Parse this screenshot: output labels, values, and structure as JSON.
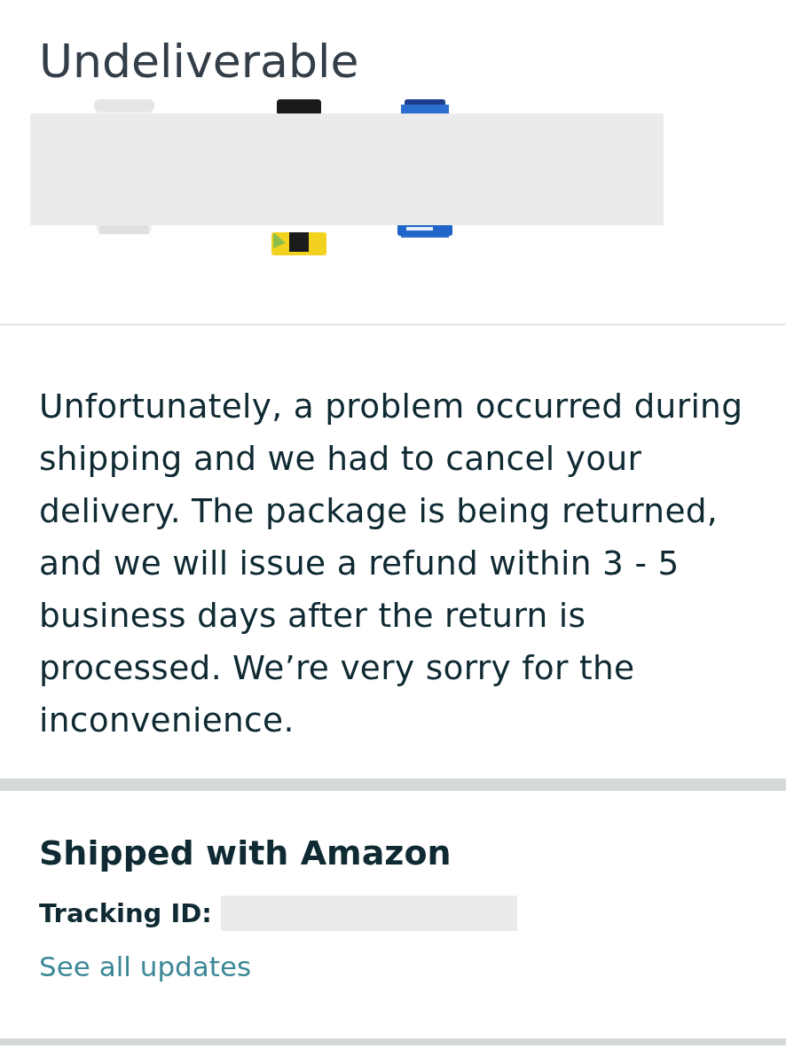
{
  "status": {
    "title": "Undeliverable"
  },
  "message": {
    "text": "Unfortunately, a problem occurred during shipping and we had to cancel your delivery. The package is being returned, and we will issue a refund within 3 - 5 business days after the return is processed. We’re very sorry for the inconvenience."
  },
  "shipment": {
    "heading": "Shipped with Amazon",
    "tracking_label": "Tracking ID:",
    "link": "See all updates"
  }
}
